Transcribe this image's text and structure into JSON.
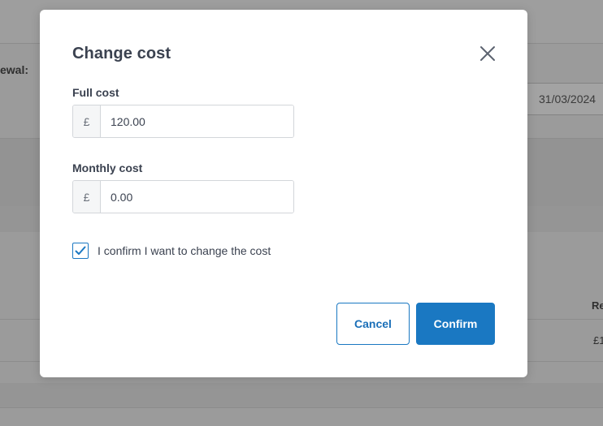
{
  "background": {
    "renewal_label": "ewal:",
    "renewal_date": "31/03/2024",
    "column_header_fragment": "Re",
    "row_value_fragment": "£1"
  },
  "modal": {
    "title": "Change cost",
    "full_cost": {
      "label": "Full cost",
      "currency": "£",
      "value": "120.00"
    },
    "monthly_cost": {
      "label": "Monthly cost",
      "currency": "£",
      "value": "0.00"
    },
    "confirm_checkbox": {
      "label": "I confirm I want to change the cost",
      "checked": true
    },
    "cancel_label": "Cancel",
    "confirm_label": "Confirm"
  },
  "colors": {
    "primary": "#1a78c2",
    "text": "#3b4250",
    "overlay": "#9b9b9b"
  },
  "icons": {
    "close": "close-icon",
    "check": "check-icon"
  }
}
